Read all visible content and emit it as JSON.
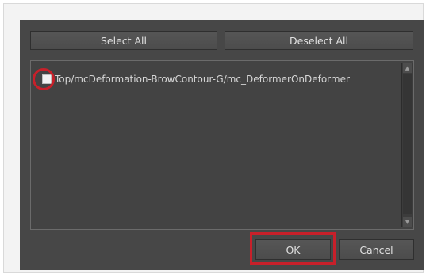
{
  "dialog": {
    "select_all_label": "Select All",
    "deselect_all_label": "Deselect All",
    "list_items": [
      {
        "label": "Top/mcDeformation-BrowContour-G/mc_DeformerOnDeformer",
        "checked": false
      }
    ],
    "scroll_up_glyph": "▲",
    "scroll_down_glyph": "▼",
    "ok_label": "OK",
    "cancel_label": "Cancel"
  },
  "annotations": {
    "highlight_color": "#c8202a"
  }
}
